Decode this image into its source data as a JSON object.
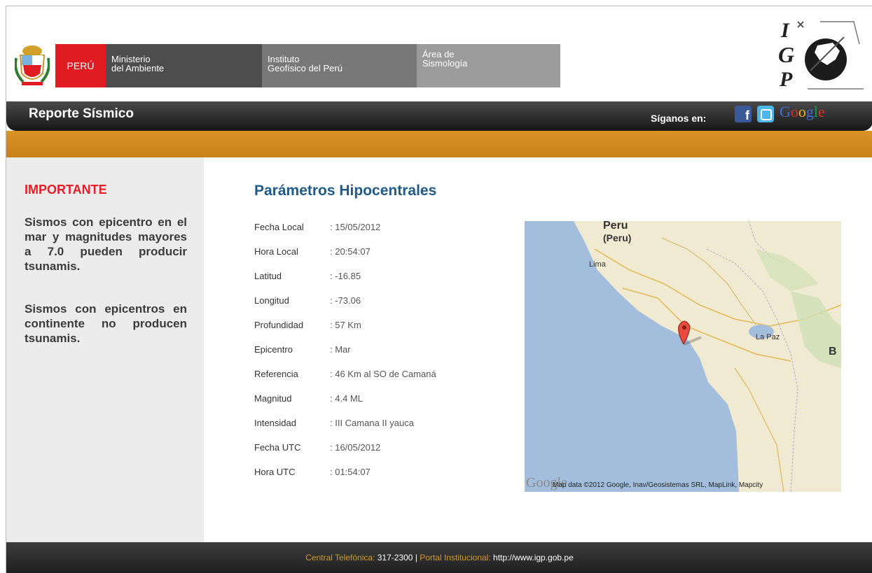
{
  "header": {
    "peru_label": "PERÚ",
    "ministry_line1": "Ministerio",
    "ministry_line2": "del Ambiente",
    "institute_line1": "Instituto",
    "institute_line2": "Geofísico del Perú",
    "area_line1": "Área de",
    "area_line2": "Sismología",
    "igp_letters": [
      "I",
      "G",
      "P"
    ]
  },
  "titlebar": {
    "title": "Reporte Sísmico",
    "follow_label": "Síganos en:",
    "social": [
      "facebook-icon",
      "twitter-icon",
      "google-groups-icon"
    ],
    "google_text": "Google"
  },
  "sidebar": {
    "title": "IMPORTANTE",
    "paragraph1": "Sismos con epicentro en el mar y magnitudes mayores a 7.0 pueden producir tsunamis.",
    "paragraph2": "Sismos con epicentros en continente no producen tsunamis."
  },
  "main": {
    "title": "Parámetros Hipocentrales",
    "params": [
      {
        "label": "Fecha Local",
        "value": ": 15/05/2012"
      },
      {
        "label": "Hora Local",
        "value": ": 20:54:07"
      },
      {
        "label": "Latitud",
        "value": ": -16.85"
      },
      {
        "label": "Longitud",
        "value": ": -73.06"
      },
      {
        "label": "Profundidad",
        "value": ": 57 Km"
      },
      {
        "label": "Epicentro",
        "value": ": Mar"
      },
      {
        "label": "Referencia",
        "value": ": 46 Km al SO de Camaná"
      },
      {
        "label": "Magnitud",
        "value": ": 4.4 ML"
      },
      {
        "label": "Intensidad",
        "value": ": III Camana II yauca"
      },
      {
        "label": "Fecha UTC",
        "value": ": 16/05/2012"
      },
      {
        "label": "Hora UTC",
        "value": ": 01:54:07"
      }
    ]
  },
  "map": {
    "labels": [
      "Peru",
      "(Peru)",
      "Lima",
      "La Paz",
      "B"
    ],
    "google_logo": "Google",
    "credit": "Map data ©2012 Google, Inav/Geosistemas SRL, MapLink, Mapcity",
    "colors": {
      "sea": "#a3bedd",
      "land": "#f1ead3",
      "pin": "#e74c3c"
    }
  },
  "footer": {
    "phone_label": "Central Telefónica:",
    "phone_value": "317-2300",
    "separator": "|",
    "portal_label": "Portal Institucional:",
    "portal_value": "http://www.igp.gob.pe"
  }
}
